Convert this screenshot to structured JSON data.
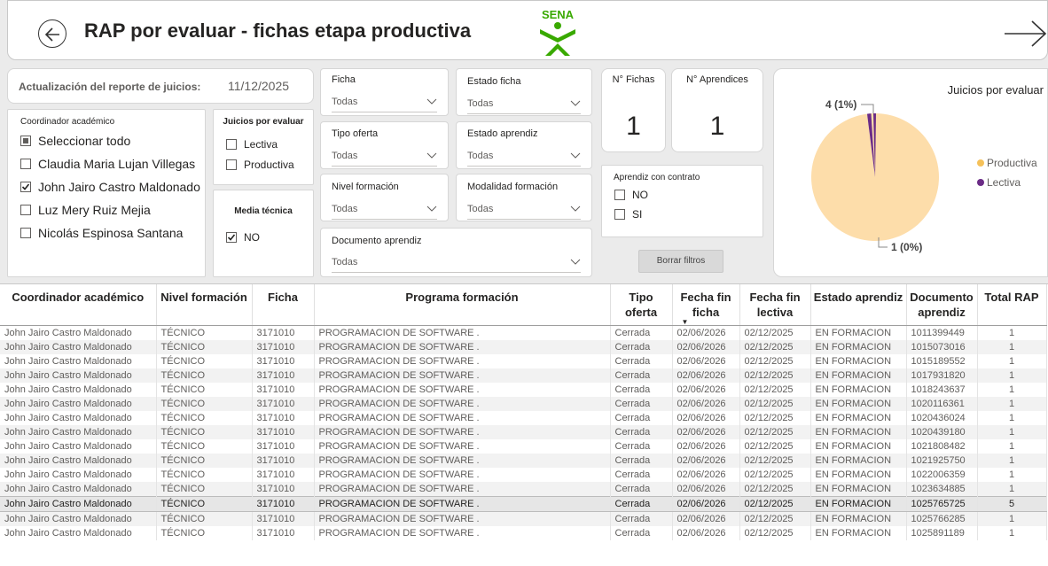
{
  "header": {
    "title": "RAP por evaluar - fichas etapa productiva",
    "logo_text": "SENA",
    "back_icon": "back-arrow-circle-icon",
    "forward_icon": "forward-arrow-icon"
  },
  "update": {
    "label": "Actualización del reporte de juicios:",
    "date": "11/12/2025"
  },
  "coordinador": {
    "title": "Coordinador académico",
    "items": [
      {
        "label": "Seleccionar todo",
        "state": "partial"
      },
      {
        "label": "Claudia Maria Lujan Villegas",
        "state": "unchecked"
      },
      {
        "label": "John Jairo Castro Maldonado",
        "state": "checked"
      },
      {
        "label": "Luz Mery Ruiz Mejia",
        "state": "unchecked"
      },
      {
        "label": "Nicolás Espinosa Santana",
        "state": "unchecked"
      }
    ]
  },
  "juicios": {
    "title": "Juicios por evaluar",
    "items": [
      {
        "label": "Lectiva",
        "state": "unchecked"
      },
      {
        "label": "Productiva",
        "state": "unchecked"
      }
    ]
  },
  "media_tecnica": {
    "title": "Media técnica",
    "items": [
      {
        "label": "NO",
        "state": "checked"
      }
    ]
  },
  "filters": {
    "ficha": {
      "label": "Ficha",
      "value": "Todas"
    },
    "estado_ficha": {
      "label": "Estado ficha",
      "value": "Todas"
    },
    "tipo_oferta": {
      "label": "Tipo oferta",
      "value": "Todas"
    },
    "estado_aprendiz": {
      "label": "Estado aprendiz",
      "value": "Todas"
    },
    "nivel_formacion": {
      "label": "Nivel formación",
      "value": "Todas"
    },
    "modalidad": {
      "label": "Modalidad formación",
      "value": "Todas"
    },
    "documento": {
      "label": "Documento aprendiz",
      "value": "Todas"
    }
  },
  "kpis": {
    "fichas": {
      "label": "N° Fichas",
      "value": "1"
    },
    "aprendices": {
      "label": "N° Aprendices",
      "value": "1"
    }
  },
  "contrato": {
    "title": "Aprendiz con contrato",
    "items": [
      {
        "label": "NO",
        "state": "unchecked"
      },
      {
        "label": "SI",
        "state": "unchecked"
      }
    ]
  },
  "clear_button": "Borrar filtros",
  "chart_data": {
    "type": "pie",
    "title": "Juicios por evaluar",
    "legend_position": "right",
    "series": [
      {
        "name": "Productiva",
        "value": 99,
        "label": "4 (1%)",
        "color": "#fdddaa"
      },
      {
        "name": "Lectiva",
        "value": 1,
        "label": "1 (0%)",
        "color": "#6b2c86"
      }
    ],
    "labels": [
      "4 (1%)",
      "1 (0%)"
    ],
    "legend": [
      {
        "name": "Productiva",
        "color": "#f5c15a"
      },
      {
        "name": "Lectiva",
        "color": "#6b2c86"
      }
    ]
  },
  "table": {
    "columns": [
      "Coordinador académico",
      "Nivel formación",
      "Ficha",
      "Programa formación",
      "Tipo oferta",
      "Fecha fin ficha",
      "Fecha fin lectiva",
      "Estado aprendiz",
      "Documento aprendiz",
      "Total RAP"
    ],
    "rows": [
      [
        "John Jairo Castro Maldonado",
        "TÉCNICO",
        "3171010",
        "PROGRAMACION DE SOFTWARE .",
        "Cerrada",
        "02/06/2026",
        "02/12/2025",
        "EN FORMACION",
        "1011399449",
        "1"
      ],
      [
        "John Jairo Castro Maldonado",
        "TÉCNICO",
        "3171010",
        "PROGRAMACION DE SOFTWARE .",
        "Cerrada",
        "02/06/2026",
        "02/12/2025",
        "EN FORMACION",
        "1015073016",
        "1"
      ],
      [
        "John Jairo Castro Maldonado",
        "TÉCNICO",
        "3171010",
        "PROGRAMACION DE SOFTWARE .",
        "Cerrada",
        "02/06/2026",
        "02/12/2025",
        "EN FORMACION",
        "1015189552",
        "1"
      ],
      [
        "John Jairo Castro Maldonado",
        "TÉCNICO",
        "3171010",
        "PROGRAMACION DE SOFTWARE .",
        "Cerrada",
        "02/06/2026",
        "02/12/2025",
        "EN FORMACION",
        "1017931820",
        "1"
      ],
      [
        "John Jairo Castro Maldonado",
        "TÉCNICO",
        "3171010",
        "PROGRAMACION DE SOFTWARE .",
        "Cerrada",
        "02/06/2026",
        "02/12/2025",
        "EN FORMACION",
        "1018243637",
        "1"
      ],
      [
        "John Jairo Castro Maldonado",
        "TÉCNICO",
        "3171010",
        "PROGRAMACION DE SOFTWARE .",
        "Cerrada",
        "02/06/2026",
        "02/12/2025",
        "EN FORMACION",
        "1020116361",
        "1"
      ],
      [
        "John Jairo Castro Maldonado",
        "TÉCNICO",
        "3171010",
        "PROGRAMACION DE SOFTWARE .",
        "Cerrada",
        "02/06/2026",
        "02/12/2025",
        "EN FORMACION",
        "1020436024",
        "1"
      ],
      [
        "John Jairo Castro Maldonado",
        "TÉCNICO",
        "3171010",
        "PROGRAMACION DE SOFTWARE .",
        "Cerrada",
        "02/06/2026",
        "02/12/2025",
        "EN FORMACION",
        "1020439180",
        "1"
      ],
      [
        "John Jairo Castro Maldonado",
        "TÉCNICO",
        "3171010",
        "PROGRAMACION DE SOFTWARE .",
        "Cerrada",
        "02/06/2026",
        "02/12/2025",
        "EN FORMACION",
        "1021808482",
        "1"
      ],
      [
        "John Jairo Castro Maldonado",
        "TÉCNICO",
        "3171010",
        "PROGRAMACION DE SOFTWARE .",
        "Cerrada",
        "02/06/2026",
        "02/12/2025",
        "EN FORMACION",
        "1021925750",
        "1"
      ],
      [
        "John Jairo Castro Maldonado",
        "TÉCNICO",
        "3171010",
        "PROGRAMACION DE SOFTWARE .",
        "Cerrada",
        "02/06/2026",
        "02/12/2025",
        "EN FORMACION",
        "1022006359",
        "1"
      ],
      [
        "John Jairo Castro Maldonado",
        "TÉCNICO",
        "3171010",
        "PROGRAMACION DE SOFTWARE .",
        "Cerrada",
        "02/06/2026",
        "02/12/2025",
        "EN FORMACION",
        "1023634885",
        "1"
      ],
      [
        "John Jairo Castro Maldonado",
        "TÉCNICO",
        "3171010",
        "PROGRAMACION DE SOFTWARE .",
        "Cerrada",
        "02/06/2026",
        "02/12/2025",
        "EN FORMACION",
        "1025765725",
        "5"
      ],
      [
        "John Jairo Castro Maldonado",
        "TÉCNICO",
        "3171010",
        "PROGRAMACION DE SOFTWARE .",
        "Cerrada",
        "02/06/2026",
        "02/12/2025",
        "EN FORMACION",
        "1025766285",
        "1"
      ],
      [
        "John Jairo Castro Maldonado",
        "TÉCNICO",
        "3171010",
        "PROGRAMACION DE SOFTWARE .",
        "Cerrada",
        "02/06/2026",
        "02/12/2025",
        "EN FORMACION",
        "1025891189",
        "1"
      ]
    ],
    "selected_row": 12,
    "sort_icon": "sort-descending-icon"
  }
}
